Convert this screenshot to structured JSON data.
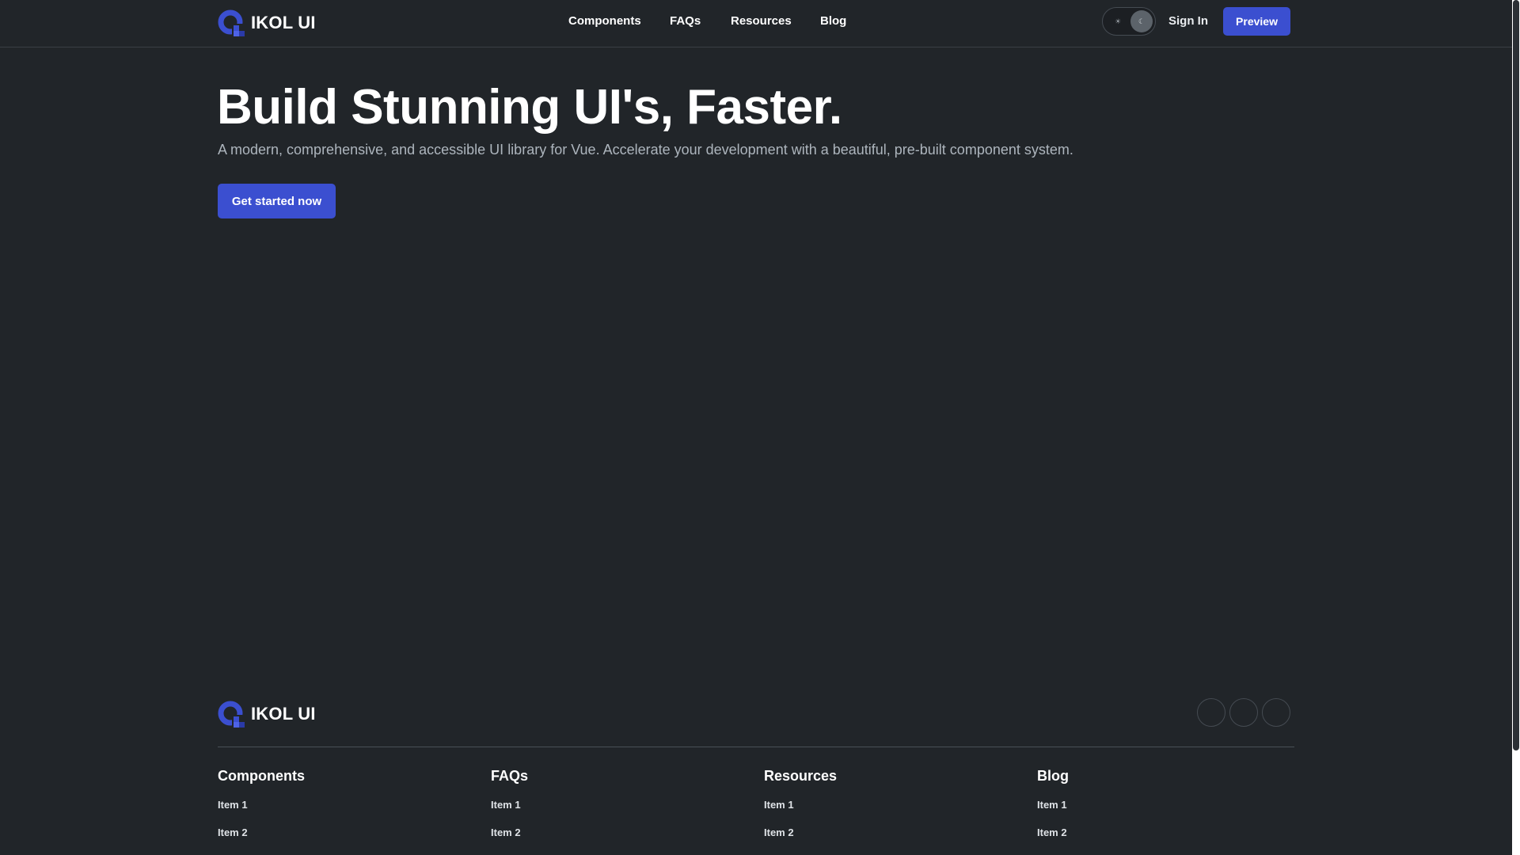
{
  "brand": {
    "name": "IKOL UI"
  },
  "nav": {
    "items": [
      "Components",
      "FAQs",
      "Resources",
      "Blog"
    ]
  },
  "header": {
    "theme_toggle": {
      "light_icon": "sun-icon",
      "dark_icon": "moon-icon",
      "selected": "dark"
    },
    "sign_in_label": "Sign In",
    "preview_label": "Preview"
  },
  "hero": {
    "title": "Build Stunning UI's, Faster.",
    "subtitle": "A modern, comprehensive, and accessible UI library for Vue. Accelerate your development with a beautiful, pre-built component system.",
    "cta_label": "Get started now"
  },
  "footer": {
    "brand_name": "IKOL UI",
    "social_icons": [
      "social-icon-1",
      "social-icon-2",
      "social-icon-3"
    ],
    "columns": [
      {
        "title": "Components",
        "items": [
          "Item 1",
          "Item 2"
        ]
      },
      {
        "title": "FAQs",
        "items": [
          "Item 1",
          "Item 2"
        ]
      },
      {
        "title": "Resources",
        "items": [
          "Item 1",
          "Item 2"
        ]
      },
      {
        "title": "Blog",
        "items": [
          "Item 1",
          "Item 2"
        ]
      }
    ]
  },
  "colors": {
    "background": "#212529",
    "accent": "#3b4fd0",
    "text_primary": "#ffffff",
    "text_muted": "#adb5bd"
  }
}
